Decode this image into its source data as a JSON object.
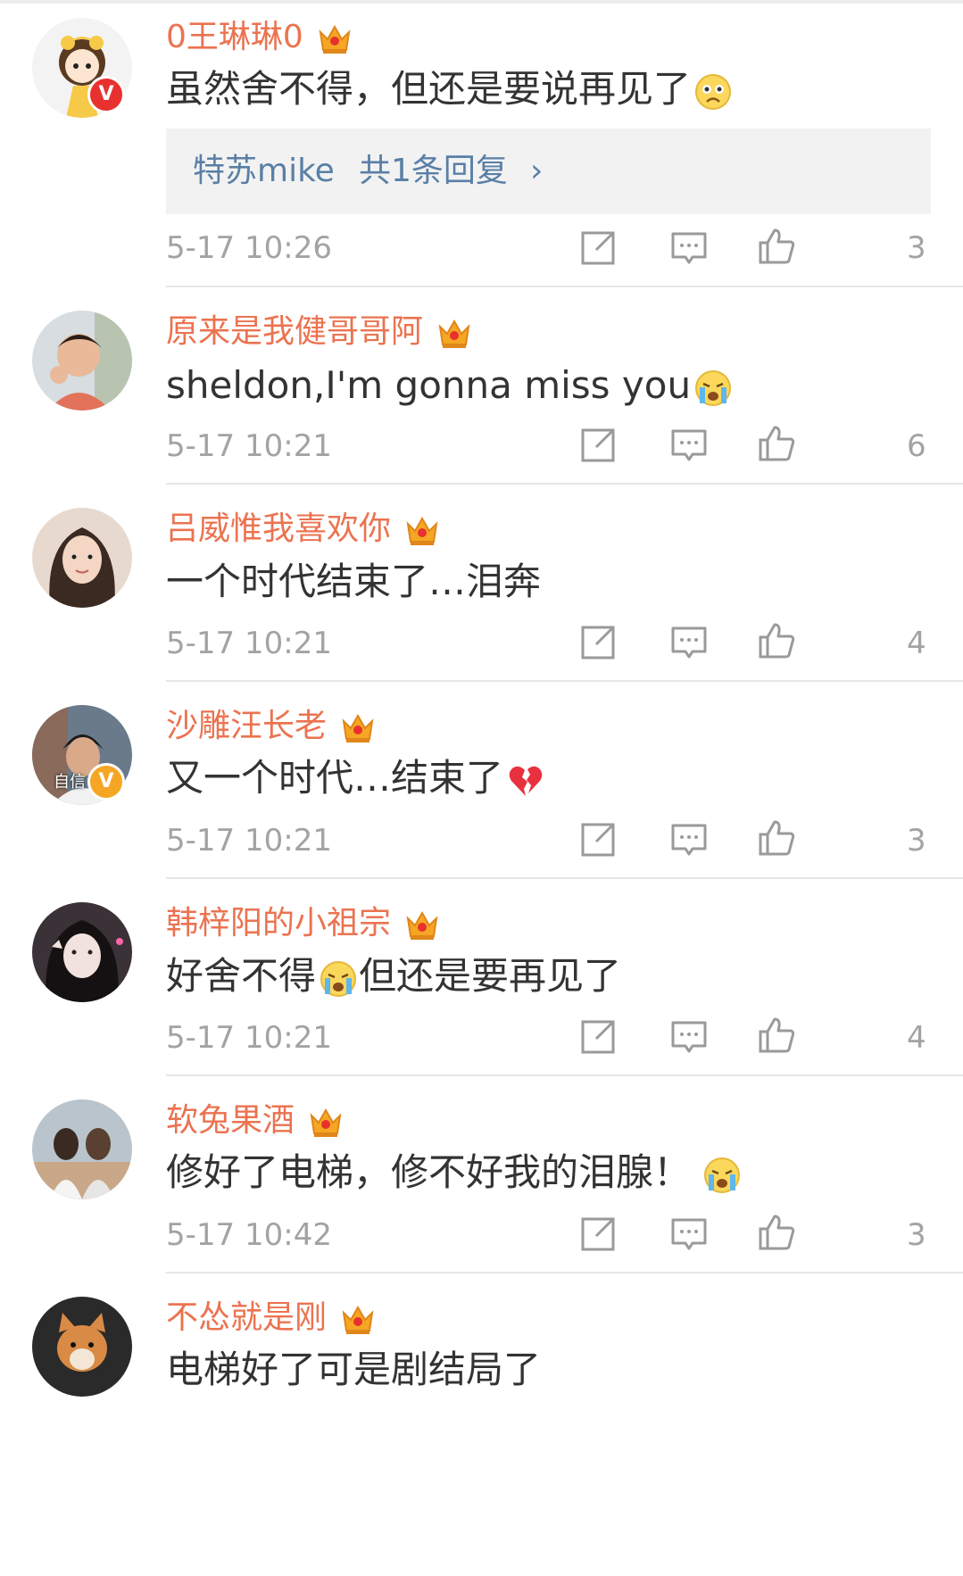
{
  "comments": [
    {
      "username": "0王琳琳0",
      "text": "虽然舍不得，但还是要说再见了",
      "emoji": "sad-face-icon",
      "reply": {
        "user": "特苏mike",
        "count_label": "共1条回复",
        "chevron": "›"
      },
      "time": "5-17 10:26",
      "likes": "3",
      "badge": "V"
    },
    {
      "username": "原来是我健哥哥阿",
      "text": "sheldon,I'm gonna miss you",
      "emoji": "crying-face-icon",
      "time": "5-17 10:21",
      "likes": "6"
    },
    {
      "username": "吕威惟我喜欢你",
      "text": "一个时代结束了…泪奔",
      "time": "5-17 10:21",
      "likes": "4"
    },
    {
      "username": "沙雕汪长老",
      "text": "又一个时代…结束了",
      "emoji": "broken-heart-icon",
      "time": "5-17 10:21",
      "likes": "3",
      "badge": "V",
      "avatar_caption": "自信"
    },
    {
      "username": "韩梓阳的小祖宗",
      "text_before": "好舍不得",
      "text_after": "但还是要再见了",
      "emoji": "crying-face-icon",
      "time": "5-17 10:21",
      "likes": "4"
    },
    {
      "username": "软兔果酒",
      "text": "修好了电梯，修不好我的泪腺！",
      "emoji": "crying-face-icon",
      "time": "5-17 10:42",
      "likes": "3"
    },
    {
      "username": "不怂就是刚",
      "text": "电梯好了可是剧结局了"
    }
  ],
  "colors": {
    "username": "#eb7350",
    "text": "#333333",
    "meta": "#a3a3a3",
    "reply_link": "#5a7fa6",
    "reply_bg": "#f2f2f2",
    "crown": "#f5a623"
  }
}
